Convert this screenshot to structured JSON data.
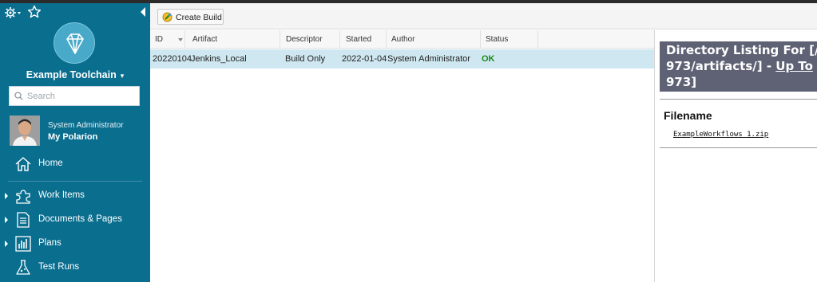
{
  "sidebar": {
    "project_name": "Example Toolchain",
    "project_caret": "▾",
    "search_placeholder": "Search",
    "user_role": "System Administrator",
    "user_link": "My Polarion",
    "nav": [
      {
        "label": "Home",
        "icon": "home-icon",
        "expandable": false
      },
      {
        "label": "Work Items",
        "icon": "puzzle-icon",
        "expandable": true
      },
      {
        "label": "Documents & Pages",
        "icon": "document-icon",
        "expandable": true
      },
      {
        "label": "Plans",
        "icon": "chart-icon",
        "expandable": true
      },
      {
        "label": "Test Runs",
        "icon": "flask-icon",
        "expandable": false
      }
    ]
  },
  "toolbar": {
    "create_build_label": "Create Build"
  },
  "builds_table": {
    "columns": [
      "ID",
      "Artifact",
      "Descriptor",
      "Started",
      "Author",
      "Status"
    ],
    "rows": [
      {
        "id": "20220104",
        "artifact": "Jenkins_Local",
        "descriptor": "Build Only",
        "started": "2022-01-04",
        "author": "System Administrator",
        "status": "OK"
      }
    ]
  },
  "directory_panel": {
    "line1": "Directory Listing For [/",
    "line2_start": "973/artifacts/] - ",
    "line2_link": "Up To",
    "line3": "973]",
    "filename_header": "Filename",
    "files": [
      "ExampleWorkflows_1.zip"
    ]
  },
  "colors": {
    "sidebar_bg": "#0a6e8f",
    "row_selected": "#cfe7f0",
    "status_ok": "#1d8a1d",
    "dir_header_bg": "#5e6274"
  }
}
